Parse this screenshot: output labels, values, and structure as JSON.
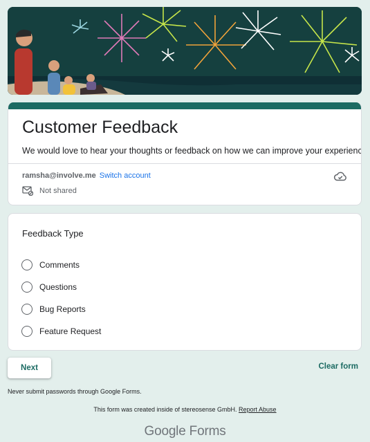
{
  "form": {
    "title": "Customer Feedback",
    "description": "We would love to hear your thoughts or feedback on how we can improve your experience!",
    "accent_color": "#1c6b63"
  },
  "account": {
    "email": "ramsha@involve.me",
    "switch_label": "Switch account",
    "share_status": "Not shared"
  },
  "question": {
    "title": "Feedback Type",
    "options": [
      "Comments",
      "Questions",
      "Bug Reports",
      "Feature Request"
    ]
  },
  "actions": {
    "next_label": "Next",
    "clear_label": "Clear form"
  },
  "footer": {
    "password_warning": "Never submit passwords through Google Forms.",
    "created_text": "This form was created inside of stereosense GmbH.",
    "report_label": "Report Abuse",
    "logo_google": "Google",
    "logo_forms": "Forms"
  }
}
